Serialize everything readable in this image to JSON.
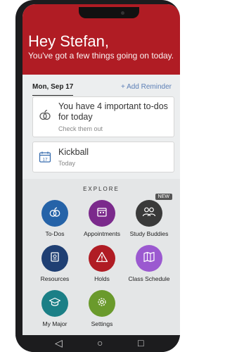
{
  "header": {
    "greeting": "Hey Stefan,",
    "subtitle": "You've got a few things going on today.",
    "color": "#b01c24"
  },
  "date_bar": {
    "date": "Mon, Sep 17",
    "add_reminder": "+ Add Reminder"
  },
  "cards": [
    {
      "icon": "apple-icon",
      "title": "You have 4 important to-dos for today",
      "subtitle": "Check them out"
    },
    {
      "icon": "calendar-17-icon",
      "title": "Kickball",
      "subtitle": "Today",
      "icon_text": "17"
    }
  ],
  "explore": {
    "heading": "EXPLORE",
    "tiles": [
      {
        "label": "To-Dos",
        "icon": "apple-icon",
        "color": "#2563a8"
      },
      {
        "label": "Appointments",
        "icon": "calendar-icon",
        "color": "#7b2a8c"
      },
      {
        "label": "Study Buddies",
        "icon": "people-icon",
        "color": "#3a3a3a",
        "badge": "NEW"
      },
      {
        "label": "Resources",
        "icon": "book-icon",
        "color": "#1f3f73"
      },
      {
        "label": "Holds",
        "icon": "warning-icon",
        "color": "#b01c24"
      },
      {
        "label": "Class Schedule",
        "icon": "map-icon",
        "color": "#9b59d0"
      },
      {
        "label": "My Major",
        "icon": "graduation-cap-icon",
        "color": "#1b7f86"
      },
      {
        "label": "Settings",
        "icon": "gear-icon",
        "color": "#6a9a2c"
      }
    ]
  },
  "nav": {
    "back": "◁",
    "home": "○",
    "recent": "□"
  }
}
